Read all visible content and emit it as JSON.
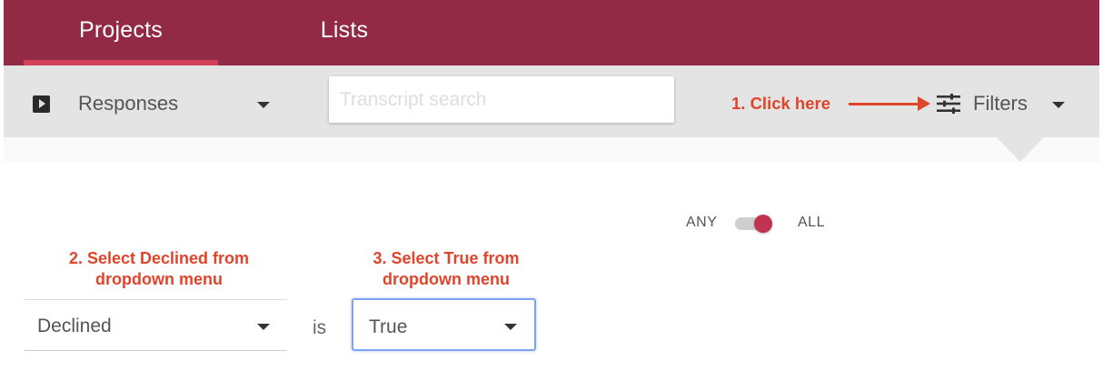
{
  "nav": {
    "tabs": [
      {
        "label": "Projects",
        "active": true
      },
      {
        "label": "Lists",
        "active": false
      }
    ]
  },
  "toolbar": {
    "view_icon": "play-icon",
    "view_select": "Responses",
    "search_placeholder": "Transcript search",
    "filters_icon": "sliders-icon",
    "filters_label": "Filters"
  },
  "annotations": {
    "step1": "1. Click here",
    "step2_line1": "2. Select Declined from",
    "step2_line2": "dropdown menu",
    "step3_line1": "3. Select True from",
    "step3_line2": "dropdown menu"
  },
  "filter_panel": {
    "match_any_label": "ANY",
    "match_all_label": "ALL",
    "match_mode": "ALL",
    "field_value": "Declined",
    "operator": "is",
    "value_value": "True"
  },
  "colors": {
    "brand": "#922945",
    "tab_underline": "#d1415c",
    "annotation": "#e0442a",
    "toggle_knob": "#c2334f",
    "focus_outline": "#7ea4f0"
  }
}
